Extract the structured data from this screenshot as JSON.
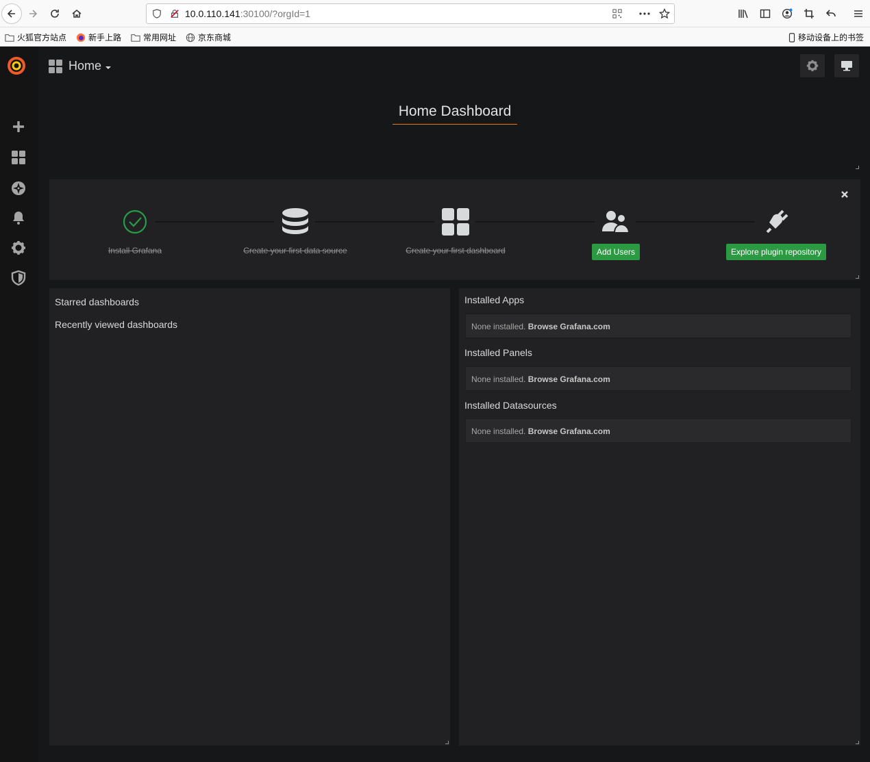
{
  "browser": {
    "url_host": "10.0.110.141",
    "url_rest": ":30100/?orgId=1",
    "bookmarks": [
      "火狐官方站点",
      "新手上路",
      "常用网址",
      "京东商城"
    ],
    "mobile_bookmarks": "移动设备上的书签"
  },
  "navbar": {
    "title": "Home"
  },
  "home_panel": {
    "title": "Home Dashboard"
  },
  "getting_started": {
    "steps": [
      {
        "label": "Install Grafana",
        "done": true
      },
      {
        "label": "Create your first data source",
        "done": true
      },
      {
        "label": "Create your first dashboard",
        "done": true
      },
      {
        "label": "Add Users",
        "done": false
      },
      {
        "label": "Explore plugin repository",
        "done": false
      }
    ],
    "colors": {
      "accent": "#2b9a43",
      "check": "#299c46"
    }
  },
  "dashboards": {
    "starred": "Starred dashboards",
    "recent": "Recently viewed dashboards"
  },
  "plugins": {
    "sections": [
      {
        "title": "Installed Apps",
        "none": "None installed.",
        "link": "Browse Grafana.com"
      },
      {
        "title": "Installed Panels",
        "none": "None installed.",
        "link": "Browse Grafana.com"
      },
      {
        "title": "Installed Datasources",
        "none": "None installed.",
        "link": "Browse Grafana.com"
      }
    ]
  }
}
